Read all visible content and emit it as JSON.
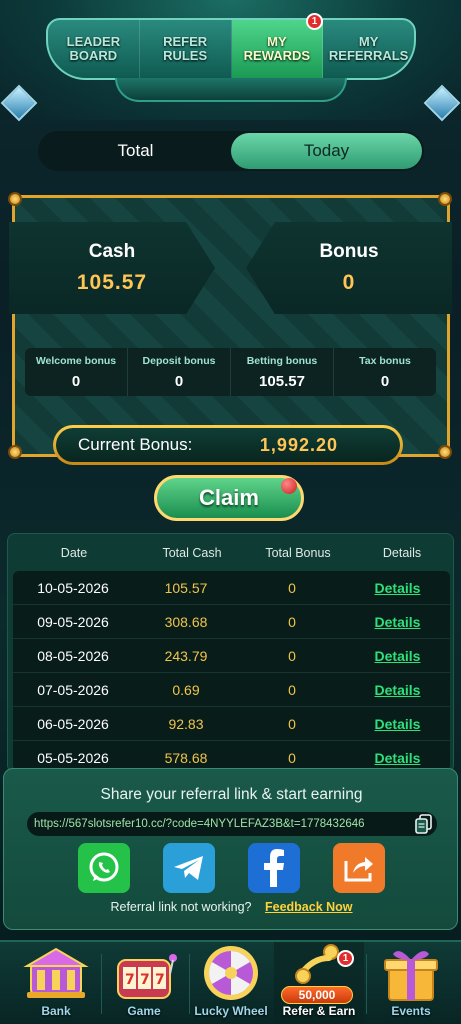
{
  "top_tabs": [
    {
      "label": "LEADER\nBOARD"
    },
    {
      "label": "REFER\nRULES"
    },
    {
      "label": "MY\nREWARDS"
    },
    {
      "label": "MY\nREFERRALS"
    }
  ],
  "top_tabs_active_index": 2,
  "rewards_badge": "1",
  "toggle": {
    "total": "Total",
    "today": "Today",
    "active": "today"
  },
  "cash": {
    "label": "Cash",
    "value": "105.57"
  },
  "bonus": {
    "label": "Bonus",
    "value": "0"
  },
  "breakdown": [
    {
      "label": "Welcome bonus",
      "value": "0"
    },
    {
      "label": "Deposit bonus",
      "value": "0"
    },
    {
      "label": "Betting bonus",
      "value": "105.57"
    },
    {
      "label": "Tax bonus",
      "value": "0"
    }
  ],
  "current_bonus": {
    "label": "Current Bonus:",
    "value": "1,992.20"
  },
  "claim_label": "Claim",
  "table": {
    "headers": [
      "Date",
      "Total Cash",
      "Total Bonus",
      "Details"
    ],
    "rows": [
      {
        "date": "10-05-2026",
        "total_cash": "105.57",
        "total_bonus": "0",
        "details": "Details"
      },
      {
        "date": "09-05-2026",
        "total_cash": "308.68",
        "total_bonus": "0",
        "details": "Details"
      },
      {
        "date": "08-05-2026",
        "total_cash": "243.79",
        "total_bonus": "0",
        "details": "Details"
      },
      {
        "date": "07-05-2026",
        "total_cash": "0.69",
        "total_bonus": "0",
        "details": "Details"
      },
      {
        "date": "06-05-2026",
        "total_cash": "92.83",
        "total_bonus": "0",
        "details": "Details"
      },
      {
        "date": "05-05-2026",
        "total_cash": "578.68",
        "total_bonus": "0",
        "details": "Details"
      }
    ]
  },
  "share": {
    "title": "Share your referral link & start earning",
    "link": "https://567slotsrefer10.cc/?code=4NYYLEFAZ3B&t=1778432646",
    "icons": [
      "whatsapp-icon",
      "telegram-icon",
      "facebook-icon",
      "share-icon"
    ],
    "not_working": "Referral link not working?",
    "feedback": "Feedback Now"
  },
  "bottom_nav": {
    "items": [
      {
        "label": "Bank"
      },
      {
        "label": "Game"
      },
      {
        "label": "Lucky Wheel"
      },
      {
        "label": "Refer & Earn"
      },
      {
        "label": "Events"
      }
    ],
    "active_index": 3,
    "refer_badge": "1",
    "refer_amount": "50,000"
  },
  "colors": {
    "accent_green": "#2fe07a",
    "gold": "#ffc555",
    "badge_red": "#e22d2d"
  }
}
